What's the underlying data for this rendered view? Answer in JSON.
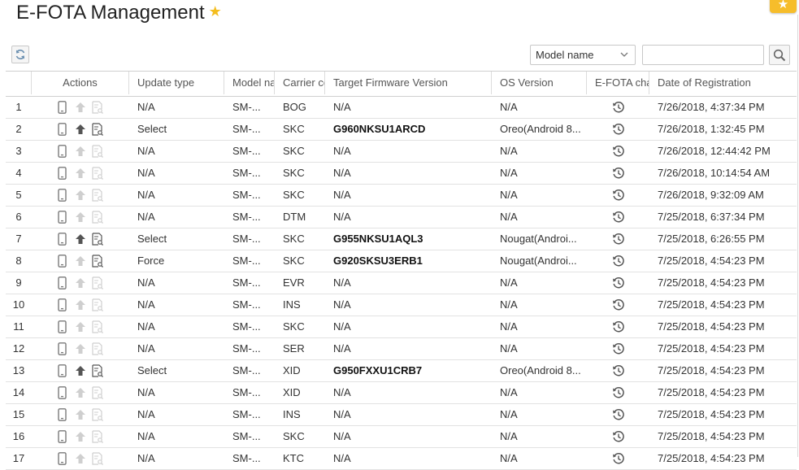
{
  "page": {
    "title": "E-FOTA Management"
  },
  "toolbar": {
    "search_field_selected": "Model name",
    "search_value": ""
  },
  "columns": {
    "num": "",
    "actions": "Actions",
    "update_type": "Update type",
    "model_name": "Model name",
    "carrier_code": "Carrier code",
    "target_firmware": "Target Firmware Version",
    "os_version": "OS Version",
    "efota_change": "E-FOTA change history",
    "date_registration": "Date of Registration"
  },
  "rows": [
    {
      "num": "1",
      "update_type": "N/A",
      "model": "SM-...",
      "carrier": "BOG",
      "firmware": "N/A",
      "os": "N/A",
      "date": "7/26/2018, 4:37:34 PM",
      "active": false
    },
    {
      "num": "2",
      "update_type": "Select",
      "model": "SM-...",
      "carrier": "SKC",
      "firmware": "G960NKSU1ARCD",
      "os": "Oreo(Android 8...",
      "date": "7/26/2018, 1:32:45 PM",
      "active": true
    },
    {
      "num": "3",
      "update_type": "N/A",
      "model": "SM-...",
      "carrier": "SKC",
      "firmware": "N/A",
      "os": "N/A",
      "date": "7/26/2018, 12:44:42 PM",
      "active": false
    },
    {
      "num": "4",
      "update_type": "N/A",
      "model": "SM-...",
      "carrier": "SKC",
      "firmware": "N/A",
      "os": "N/A",
      "date": "7/26/2018, 10:14:54 AM",
      "active": false
    },
    {
      "num": "5",
      "update_type": "N/A",
      "model": "SM-...",
      "carrier": "SKC",
      "firmware": "N/A",
      "os": "N/A",
      "date": "7/26/2018, 9:32:09 AM",
      "active": false
    },
    {
      "num": "6",
      "update_type": "N/A",
      "model": "SM-...",
      "carrier": "DTM",
      "firmware": "N/A",
      "os": "N/A",
      "date": "7/25/2018, 6:37:34 PM",
      "active": false
    },
    {
      "num": "7",
      "update_type": "Select",
      "model": "SM-...",
      "carrier": "SKC",
      "firmware": "G955NKSU1AQL3",
      "os": "Nougat(Androi...",
      "date": "7/25/2018, 6:26:55 PM",
      "active": true
    },
    {
      "num": "8",
      "update_type": "Force",
      "model": "SM-...",
      "carrier": "SKC",
      "firmware": "G920SKSU3ERB1",
      "os": "Nougat(Androi...",
      "date": "7/25/2018, 4:54:23 PM",
      "active": false,
      "report_active": true
    },
    {
      "num": "9",
      "update_type": "N/A",
      "model": "SM-...",
      "carrier": "EVR",
      "firmware": "N/A",
      "os": "N/A",
      "date": "7/25/2018, 4:54:23 PM",
      "active": false
    },
    {
      "num": "10",
      "update_type": "N/A",
      "model": "SM-...",
      "carrier": "INS",
      "firmware": "N/A",
      "os": "N/A",
      "date": "7/25/2018, 4:54:23 PM",
      "active": false
    },
    {
      "num": "11",
      "update_type": "N/A",
      "model": "SM-...",
      "carrier": "SKC",
      "firmware": "N/A",
      "os": "N/A",
      "date": "7/25/2018, 4:54:23 PM",
      "active": false
    },
    {
      "num": "12",
      "update_type": "N/A",
      "model": "SM-...",
      "carrier": "SER",
      "firmware": "N/A",
      "os": "N/A",
      "date": "7/25/2018, 4:54:23 PM",
      "active": false
    },
    {
      "num": "13",
      "update_type": "Select",
      "model": "SM-...",
      "carrier": "XID",
      "firmware": "G950FXXU1CRB7",
      "os": "Oreo(Android 8...",
      "date": "7/25/2018, 4:54:23 PM",
      "active": true
    },
    {
      "num": "14",
      "update_type": "N/A",
      "model": "SM-...",
      "carrier": "XID",
      "firmware": "N/A",
      "os": "N/A",
      "date": "7/25/2018, 4:54:23 PM",
      "active": false
    },
    {
      "num": "15",
      "update_type": "N/A",
      "model": "SM-...",
      "carrier": "INS",
      "firmware": "N/A",
      "os": "N/A",
      "date": "7/25/2018, 4:54:23 PM",
      "active": false
    },
    {
      "num": "16",
      "update_type": "N/A",
      "model": "SM-...",
      "carrier": "SKC",
      "firmware": "N/A",
      "os": "N/A",
      "date": "7/25/2018, 4:54:23 PM",
      "active": false
    },
    {
      "num": "17",
      "update_type": "N/A",
      "model": "SM-...",
      "carrier": "KTC",
      "firmware": "N/A",
      "os": "N/A",
      "date": "7/25/2018, 4:54:23 PM",
      "active": false
    }
  ],
  "colors": {
    "accent_star": "#f4bd1e",
    "corner_tab": "#f6bd2b",
    "icon_active": "#555555",
    "icon_inactive": "#cfcfcf",
    "row_border": "#e2e2e2"
  },
  "icons": {
    "favorite": "star-icon",
    "refresh": "refresh-icon",
    "search": "search-icon",
    "phone": "phone-icon",
    "upload": "upload-arrow-icon",
    "report": "report-search-icon",
    "history": "history-clock-icon"
  }
}
